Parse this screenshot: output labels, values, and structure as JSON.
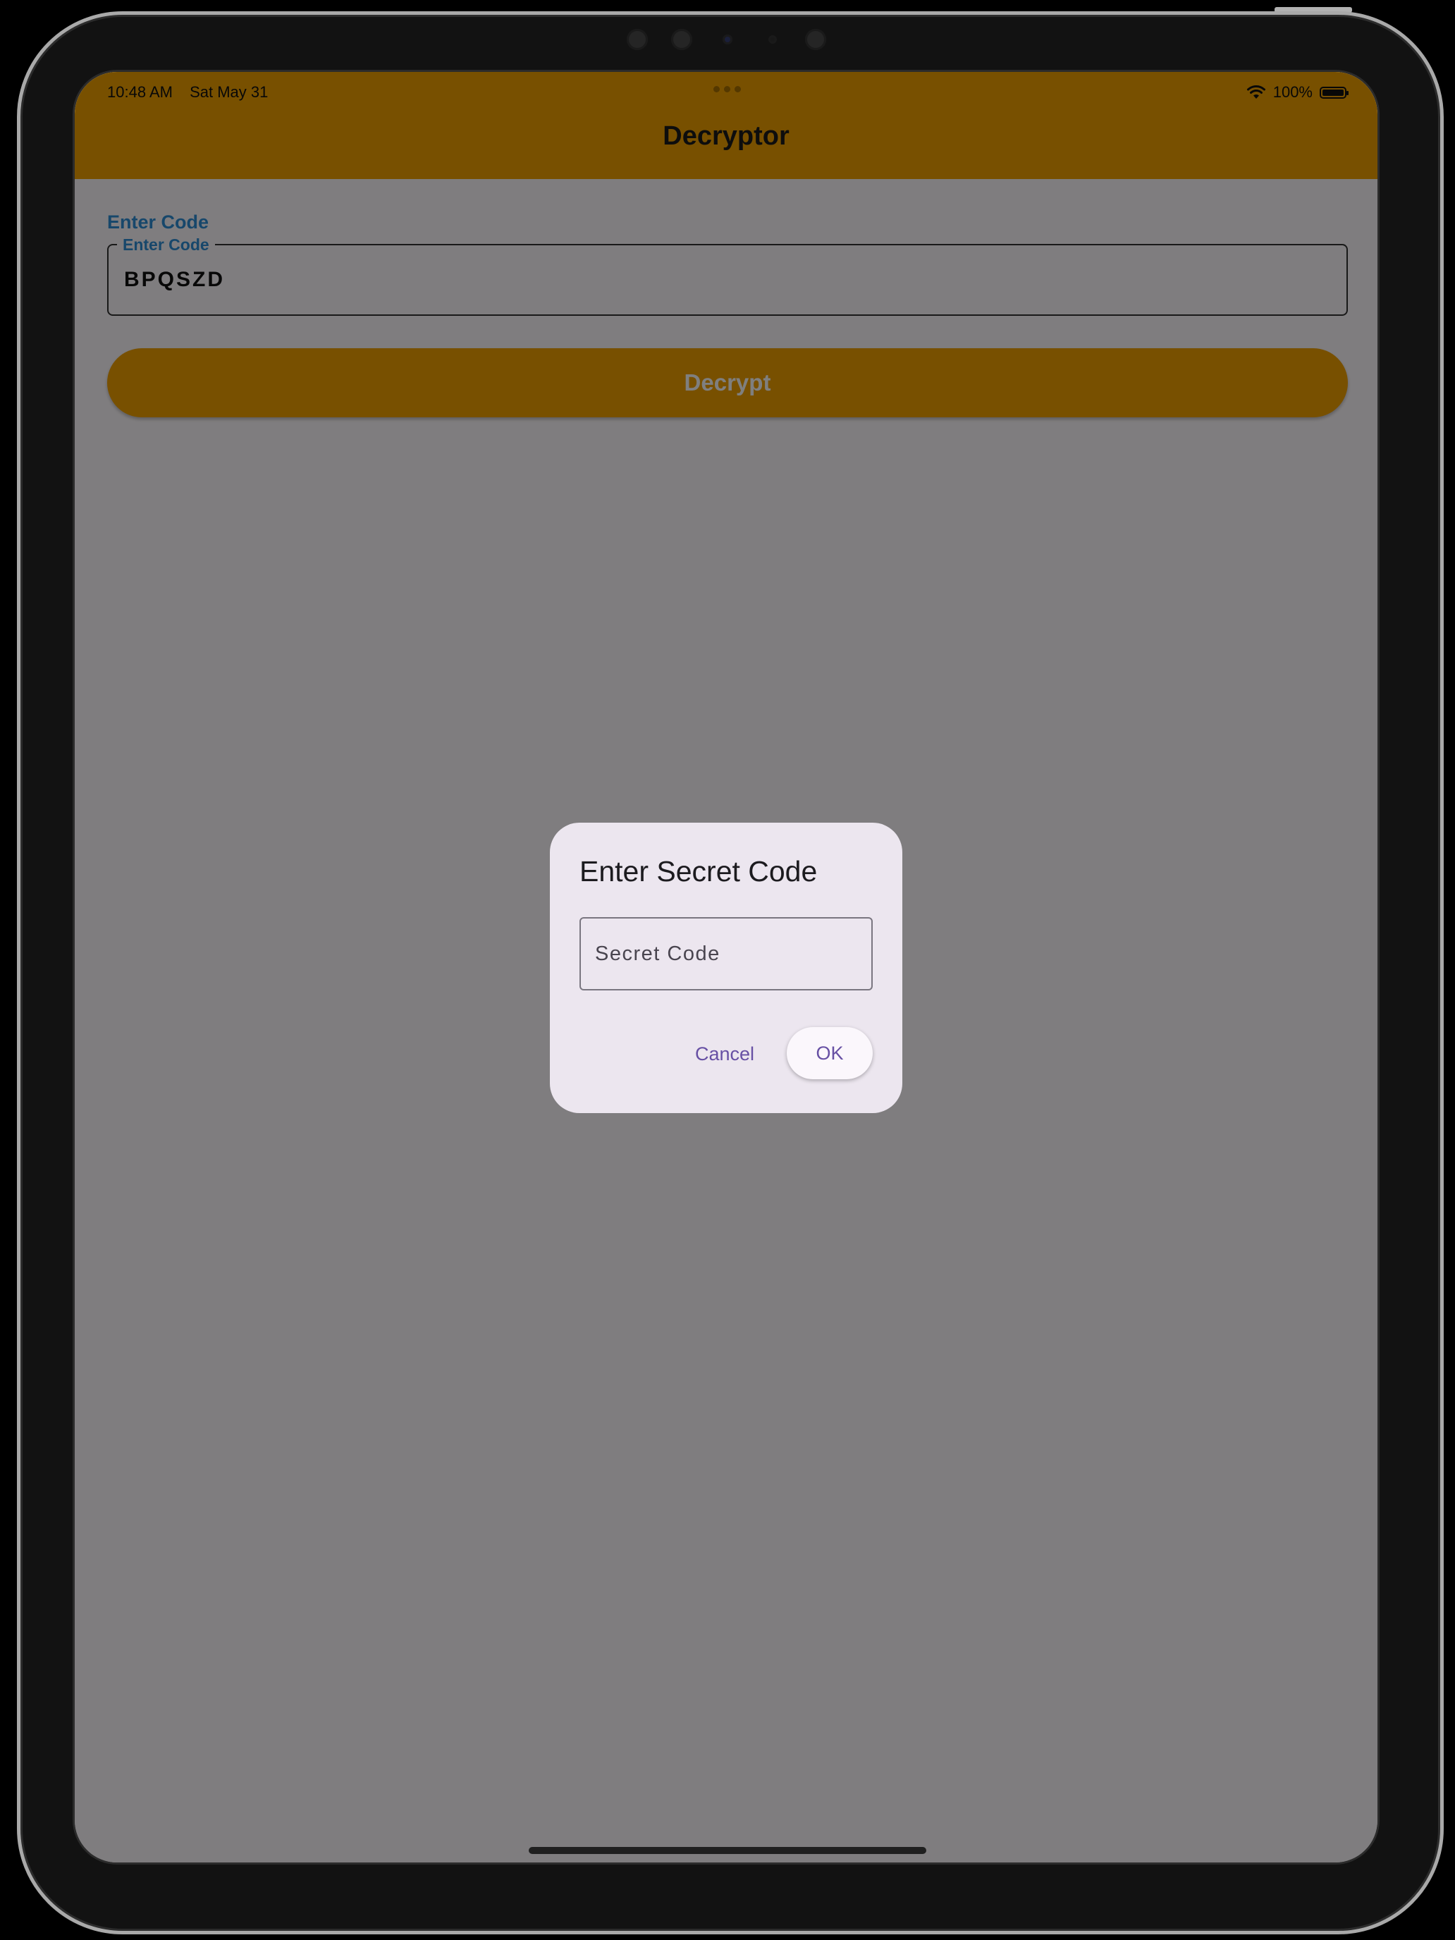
{
  "status_bar": {
    "time": "10:48 AM",
    "date": "Sat May 31",
    "battery": "100%"
  },
  "app_bar": {
    "title": "Decryptor"
  },
  "form": {
    "caption": "Enter Code",
    "field_label": "Enter Code",
    "field_value": "BPQSZD",
    "button_label": "Decrypt"
  },
  "dialog": {
    "title": "Enter Secret Code",
    "input_placeholder": "Secret Code",
    "input_value": "",
    "cancel_label": "Cancel",
    "ok_label": "OK"
  },
  "colors": {
    "accent": "#f0a000",
    "field_label": "#2f8fd6",
    "dialog_background": "#ece6ef",
    "dialog_action": "#6750a4"
  },
  "icons": [
    "wifi-icon",
    "battery-icon"
  ]
}
